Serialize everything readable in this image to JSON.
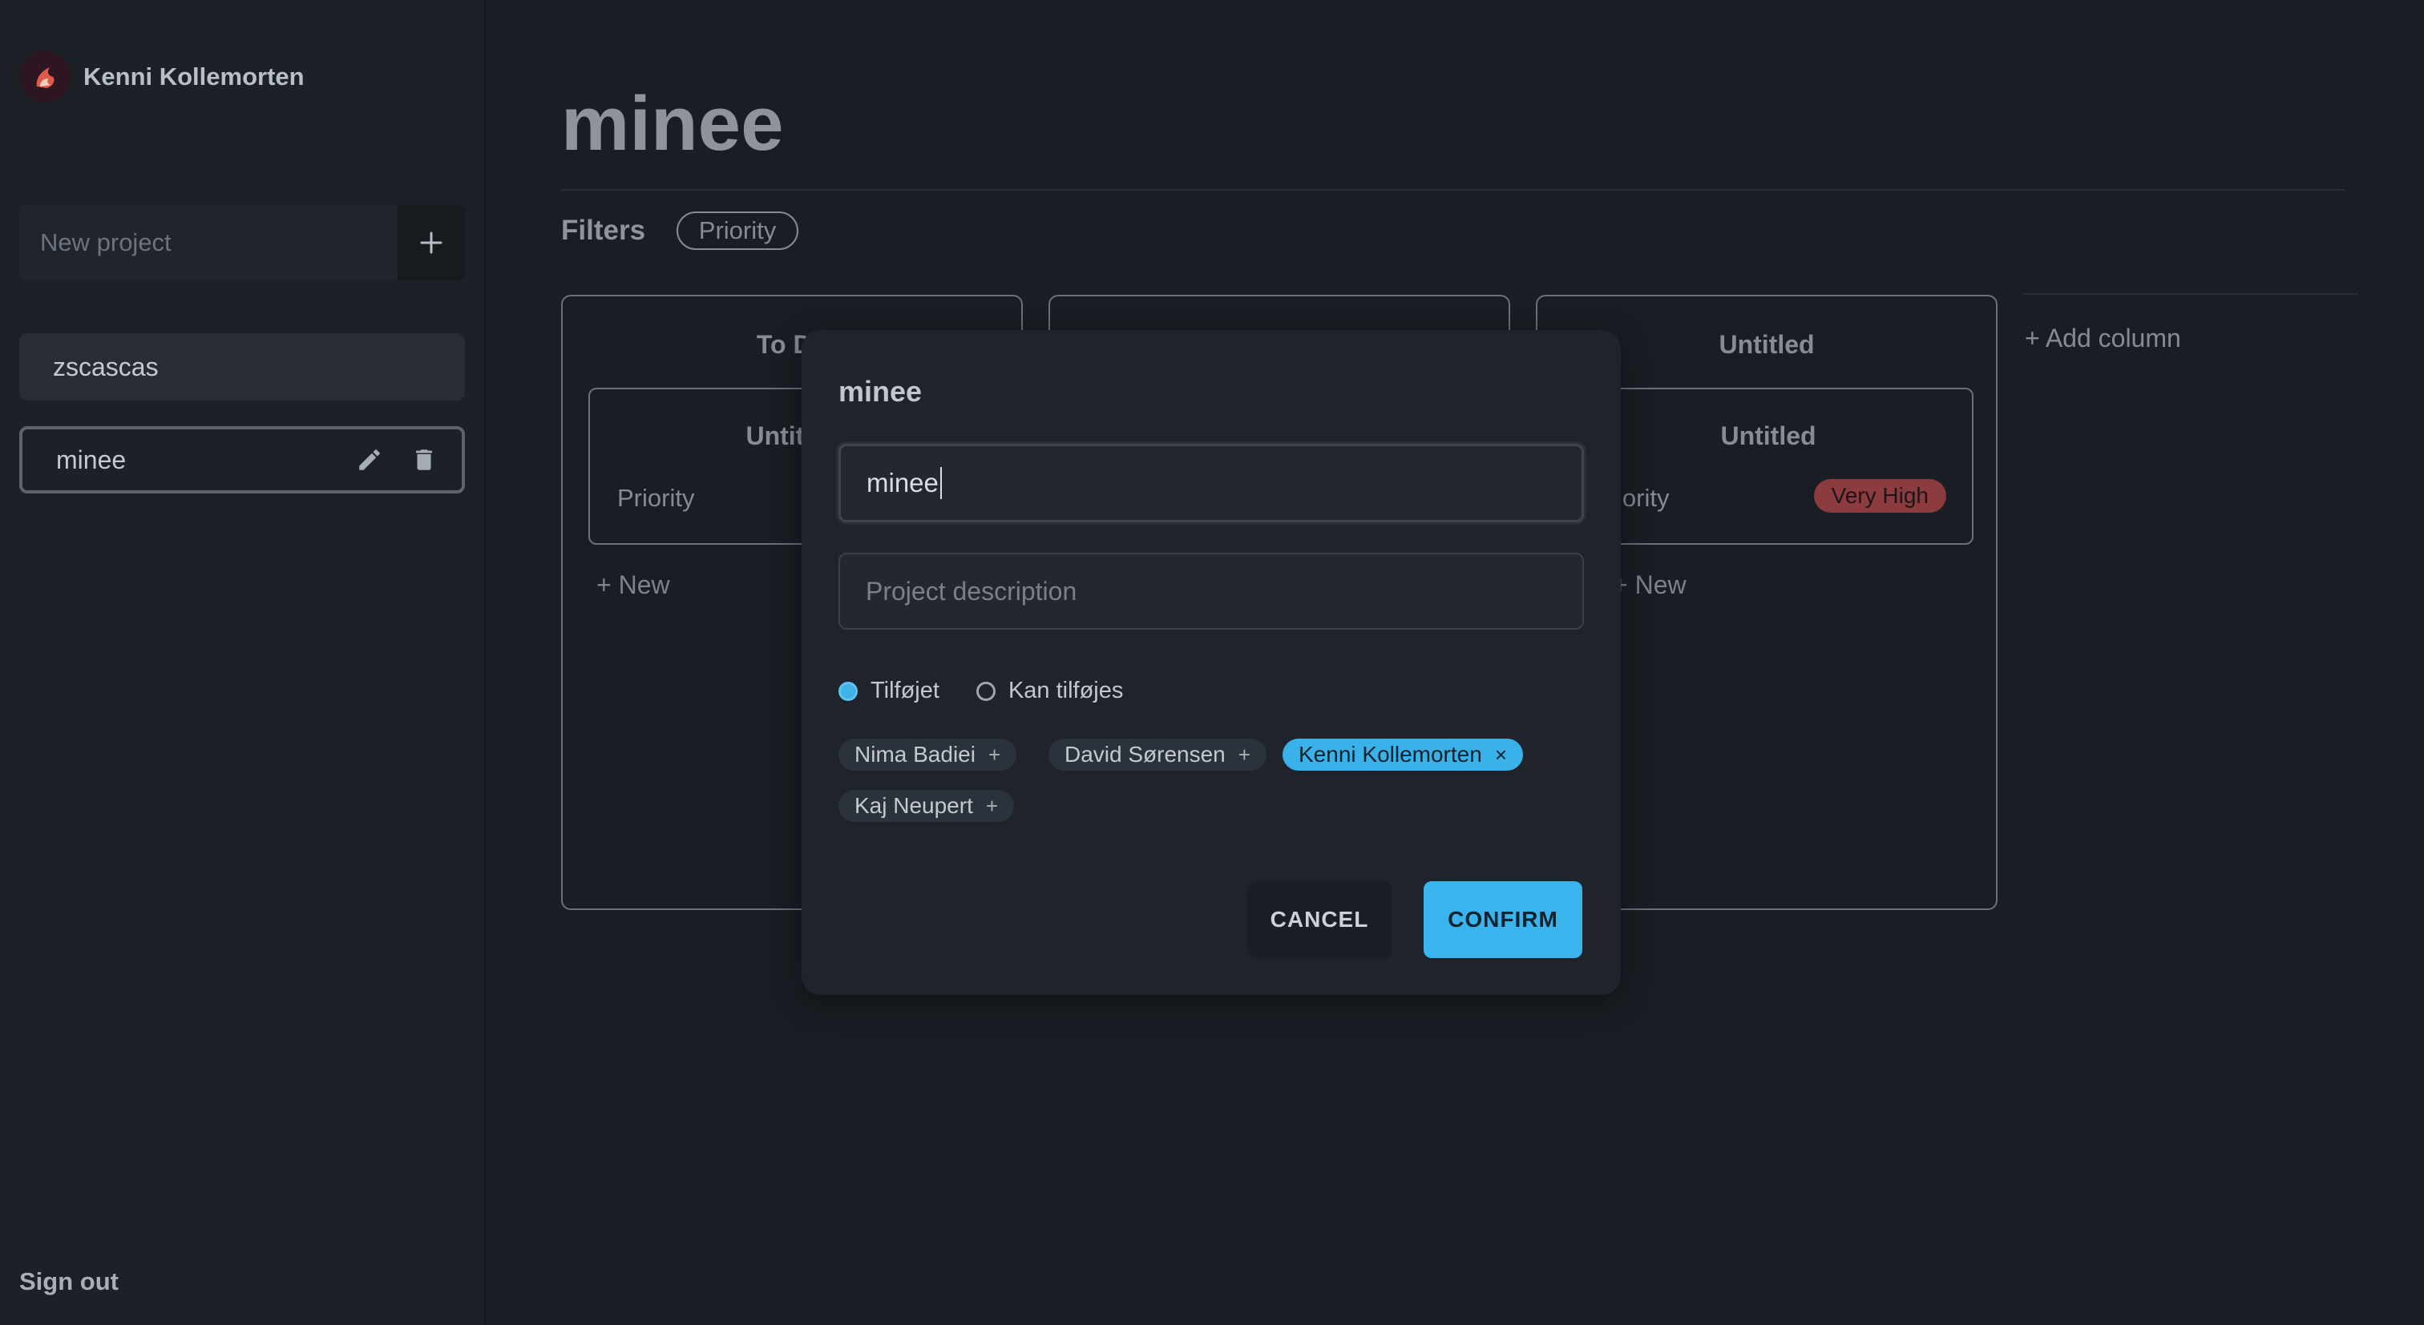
{
  "user": {
    "name": "Kenni Kollemorten"
  },
  "sidebar": {
    "new_project_placeholder": "New project",
    "projects": [
      {
        "label": "zscascas"
      },
      {
        "label": "minee"
      }
    ],
    "signout": "Sign out"
  },
  "main": {
    "title": "minee",
    "filters_label": "Filters",
    "filter_chips": [
      "Priority"
    ],
    "columns": [
      {
        "title": "To Do",
        "card_title": "Untitled",
        "card_property": "Priority",
        "new_label": "New"
      },
      {
        "title": "",
        "card_title": "",
        "card_property": "",
        "new_label": ""
      },
      {
        "title": "Untitled",
        "card_title": "Untitled",
        "card_property": "Priority",
        "badge": "Very High",
        "new_label": "New"
      }
    ],
    "add_column": "Add column"
  },
  "modal": {
    "title": "minee",
    "name_value": "minee",
    "description_placeholder": "Project description",
    "radios": [
      {
        "label": "Tilføjet",
        "selected": true
      },
      {
        "label": "Kan tilføjes",
        "selected": false
      }
    ],
    "members": [
      {
        "name": "Nima Badiei",
        "action": "+"
      },
      {
        "name": "David Sørensen",
        "action": "+"
      },
      {
        "name": "Kenni Kollemorten",
        "action": "×",
        "selected": true
      },
      {
        "name": "Kaj Neupert",
        "action": "+"
      }
    ],
    "cancel": "CANCEL",
    "confirm": "CONFIRM"
  },
  "colors": {
    "accent": "#39b4ec",
    "badge_very_high": "#8c3b3f",
    "background": "#1a1e24"
  }
}
